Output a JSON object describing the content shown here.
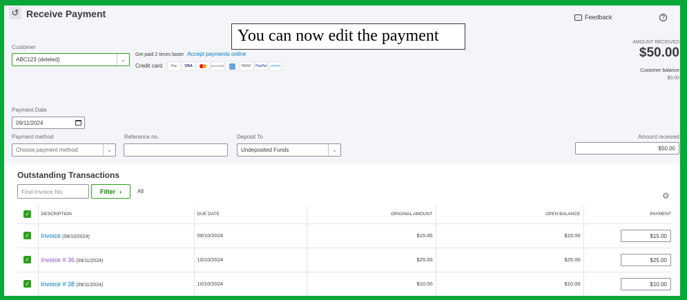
{
  "header": {
    "title": "Receive Payment",
    "feedback": "Feedback"
  },
  "banner": "You can now edit the payment",
  "customer": {
    "label": "Customer",
    "value": "ABC123 (deleted)"
  },
  "promo": {
    "text": "Get paid 2 times faster",
    "link": "Accept payments online",
    "credit_label": "Credit card",
    "cards": [
      "Pay",
      "VISA",
      "",
      "DISCOVER",
      "",
      "BANK",
      "PayPal",
      "venmo"
    ]
  },
  "summary": {
    "amount_label": "AMOUNT RECEIVED",
    "amount": "$50.00",
    "balance_label": "Customer balance",
    "balance": "$0.00"
  },
  "payment_date": {
    "label": "Payment Date",
    "value": "09/11/2024"
  },
  "payment_method": {
    "label": "Payment method",
    "placeholder": "Choose payment method"
  },
  "reference": {
    "label": "Reference no.",
    "value": ""
  },
  "deposit": {
    "label": "Deposit To",
    "value": "Undeposited Funds"
  },
  "amount_received": {
    "label": "Amount received",
    "value": "$50.00"
  },
  "outstanding": {
    "title": "Outstanding Transactions",
    "search_placeholder": "Find Invoice No.",
    "filter": "Filter",
    "all": "All",
    "columns": [
      "DESCRIPTION",
      "DUE DATE",
      "ORIGINAL AMOUNT",
      "OPEN BALANCE",
      "PAYMENT"
    ],
    "rows": [
      {
        "desc": "Invoice",
        "date": "(09/10/2024)",
        "due": "09/10/2024",
        "original": "$15.00",
        "open": "$15.00",
        "payment": "$15.00",
        "color": "#0077c5"
      },
      {
        "desc": "Invoice # 36",
        "date": "(09/11/2024)",
        "due": "10/10/2024",
        "original": "$25.00",
        "open": "$25.00",
        "payment": "$25.00",
        "color": "#8d4fd8"
      },
      {
        "desc": "Invoice # 38",
        "date": "(09/11/2024)",
        "due": "10/10/2024",
        "original": "$10.00",
        "open": "$10.00",
        "payment": "$10.00",
        "color": "#0077c5"
      }
    ]
  }
}
